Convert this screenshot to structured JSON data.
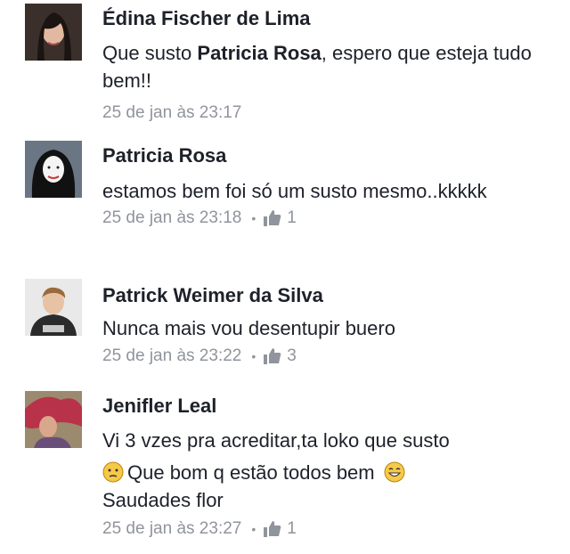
{
  "comments": [
    {
      "author": "Édina Fischer de Lima",
      "text_before": "Que susto ",
      "mention": "Patricia Rosa",
      "text_after": ", espero que esteja tudo bem!!",
      "time": "25 de jan às 23:17"
    },
    {
      "author": "Patricia Rosa",
      "text": "estamos bem foi só um susto mesmo..kkkkk",
      "time": "25 de jan às 23:18",
      "likes": "1"
    },
    {
      "author": "Patrick Weimer da Silva",
      "text": "Nunca mais vou desentupir buero",
      "time": "25 de jan às 23:22",
      "likes": "3"
    },
    {
      "author": "Jenifler Leal",
      "line1": "Vi 3 vzes pra acreditar,ta loko que susto",
      "line2": "Que bom q estão todos bem",
      "line3": "Saudades flor",
      "time": "25 de jan às 23:27",
      "likes": "1"
    }
  ],
  "separator": "•",
  "icons": {
    "like": "thumbs-up-icon",
    "emoji_confused": "confused-face-icon",
    "emoji_grin": "grinning-face-icon"
  },
  "colors": {
    "text": "#1d2129",
    "meta": "#90949c"
  }
}
